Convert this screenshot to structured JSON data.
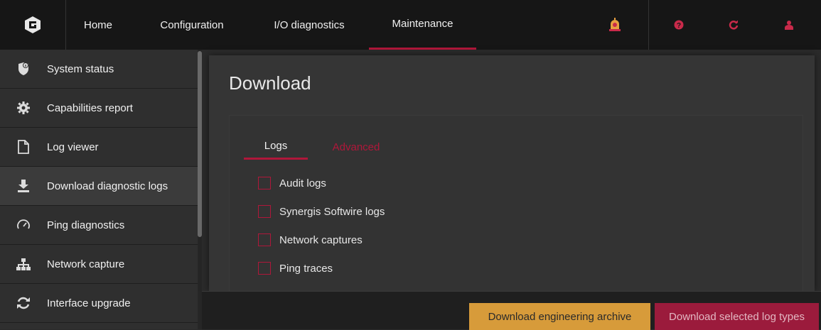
{
  "nav": {
    "items": [
      {
        "label": "Home"
      },
      {
        "label": "Configuration"
      },
      {
        "label": "I/O diagnostics"
      },
      {
        "label": "Maintenance",
        "active": true
      }
    ]
  },
  "header_icons": [
    "alarm-bell-icon",
    "help-icon",
    "refresh-icon",
    "user-icon"
  ],
  "sidebar": {
    "items": [
      {
        "label": "System status",
        "icon": "shield-info-icon"
      },
      {
        "label": "Capabilities report",
        "icon": "gear-icon"
      },
      {
        "label": "Log viewer",
        "icon": "document-icon"
      },
      {
        "label": "Download diagnostic logs",
        "icon": "download-icon",
        "active": true
      },
      {
        "label": "Ping diagnostics",
        "icon": "gauge-icon"
      },
      {
        "label": "Network capture",
        "icon": "network-icon"
      },
      {
        "label": "Interface upgrade",
        "icon": "refresh-icon"
      }
    ]
  },
  "main": {
    "title": "Download",
    "tabs": [
      {
        "label": "Logs",
        "active": true
      },
      {
        "label": "Advanced",
        "active": false
      }
    ],
    "log_types": [
      {
        "label": "Audit logs",
        "checked": false
      },
      {
        "label": "Synergis Softwire logs",
        "checked": false
      },
      {
        "label": "Network captures",
        "checked": false
      },
      {
        "label": "Ping traces",
        "checked": false
      }
    ]
  },
  "footer": {
    "archive_button": "Download engineering archive",
    "selected_button": "Download selected log types"
  },
  "colors": {
    "accent": "#b0173a",
    "orange_button": "#d79b3a",
    "topbar": "#161616"
  }
}
